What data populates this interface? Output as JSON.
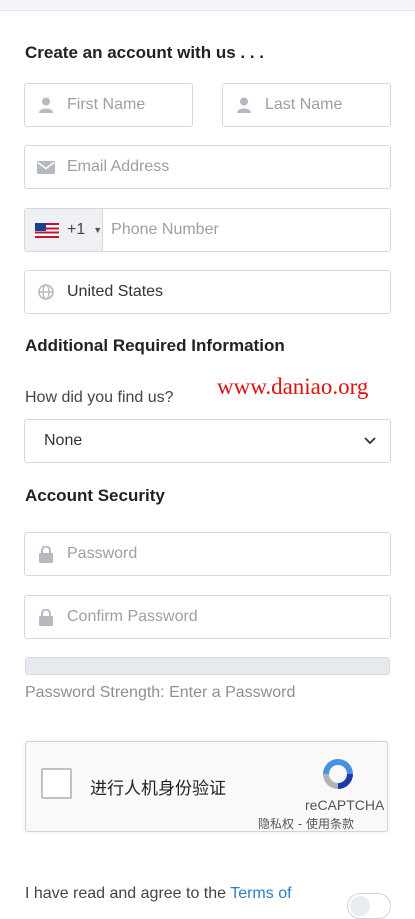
{
  "heading_account": "Create an account with us . . .",
  "fields": {
    "first_name_placeholder": "First Name",
    "last_name_placeholder": "Last Name",
    "email_placeholder": "Email Address",
    "phone_code": "+1",
    "phone_placeholder": "Phone Number",
    "country_value": "United States"
  },
  "additional": {
    "heading": "Additional Required Information",
    "question_label": "How did you find us?",
    "selected_option": "None",
    "watermark": "www.daniao.org"
  },
  "security": {
    "heading": "Account Security",
    "password_placeholder": "Password",
    "confirm_placeholder": "Confirm Password",
    "strength_text": "Password Strength: Enter a Password",
    "strength_fraction": 0
  },
  "recaptcha": {
    "label": "进行人机身份验证",
    "brand": "reCAPTCHA",
    "links": "隐私权 - 使用条款"
  },
  "terms": {
    "prefix": "I have read and agree to the ",
    "link": "Terms of"
  },
  "icons": [
    "user-icon",
    "envelope-icon",
    "us-flag-icon",
    "globe-icon",
    "chevron-down-icon",
    "lock-icon",
    "recaptcha-logo-icon"
  ],
  "colors": {
    "watermark": "#e01010",
    "link": "#2f7fc1"
  }
}
